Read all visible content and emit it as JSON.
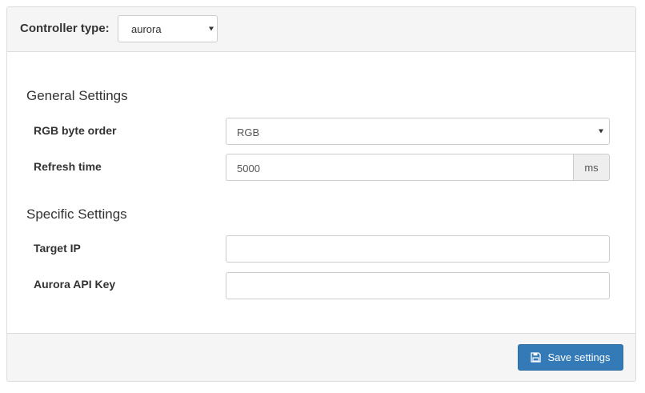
{
  "header": {
    "controller_label": "Controller type:",
    "controller_value": "aurora"
  },
  "general": {
    "title": "General Settings",
    "rgb_label": "RGB byte order",
    "rgb_value": "RGB",
    "refresh_label": "Refresh time",
    "refresh_value": "5000",
    "refresh_unit": "ms"
  },
  "specific": {
    "title": "Specific Settings",
    "target_ip_label": "Target IP",
    "target_ip_value": "",
    "api_key_label": "Aurora API Key",
    "api_key_value": ""
  },
  "footer": {
    "save_label": "Save settings"
  },
  "icons": {
    "save": "floppy-disk-icon",
    "dropdown": "caret-down-icon"
  },
  "colors": {
    "primary": "#337ab7",
    "panel_bg": "#f5f5f5",
    "border": "#dddddd"
  }
}
